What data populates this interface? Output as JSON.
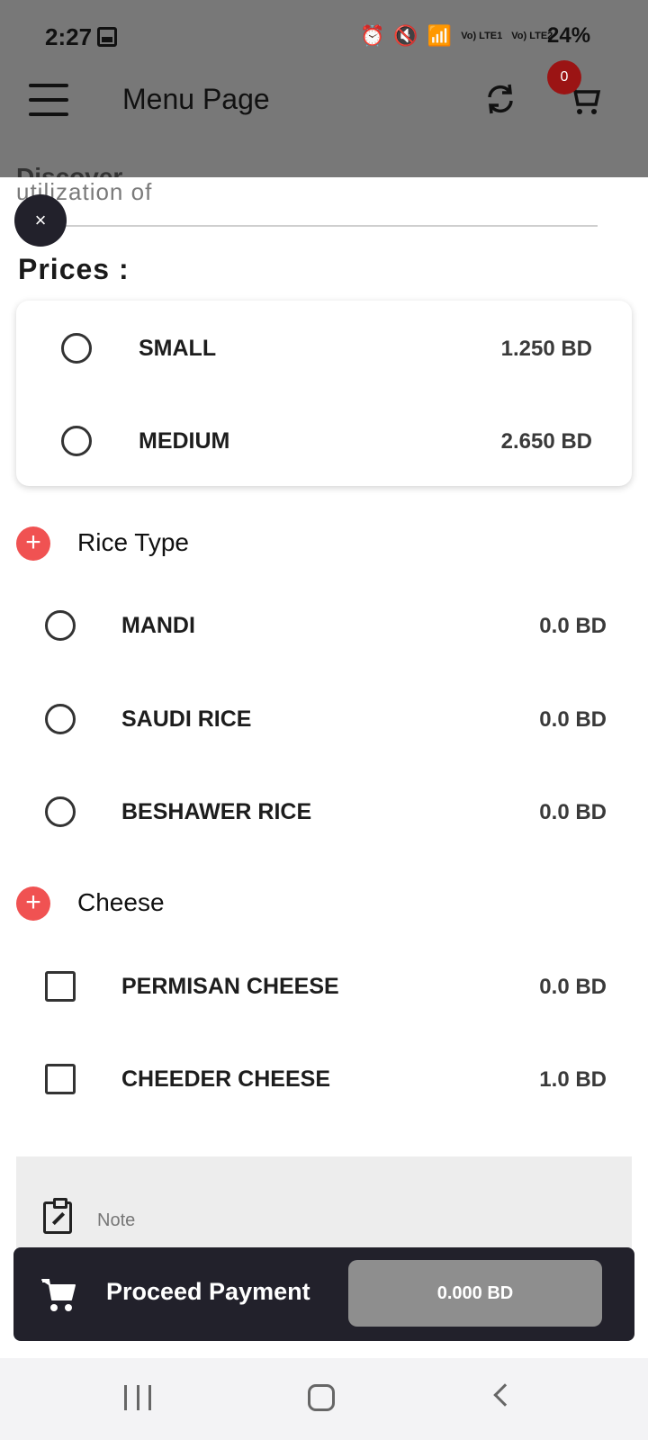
{
  "status_bar": {
    "time": "2:27",
    "signal_text": "Vo) LTE1",
    "signal_text_2": "Vo) LTE2",
    "battery": "24%"
  },
  "app_bar": {
    "title": "Menu Page",
    "cart_count": "0"
  },
  "sheet": {
    "behind_text": "Discover",
    "description_fragment": "utilization of",
    "close_label": "×",
    "prices_title": "Prices :",
    "prices": [
      {
        "label": "SMALL",
        "price": "1.250 BD",
        "selected": false
      },
      {
        "label": "MEDIUM",
        "price": "2.650 BD",
        "selected": false
      }
    ],
    "groups": [
      {
        "title": "Rice Type",
        "control": "radio",
        "options": [
          {
            "label": "MANDI",
            "price": "0.0 BD",
            "selected": false
          },
          {
            "label": "SAUDI RICE",
            "price": "0.0 BD",
            "selected": false
          },
          {
            "label": "BESHAWER RICE",
            "price": "0.0 BD",
            "selected": false
          }
        ]
      },
      {
        "title": "Cheese",
        "control": "checkbox",
        "options": [
          {
            "label": "PERMISAN CHEESE",
            "price": "0.0 BD",
            "selected": false
          },
          {
            "label": "CHEEDER CHEESE",
            "price": "1.0 BD",
            "selected": false
          }
        ]
      }
    ],
    "note_placeholder": "Note"
  },
  "payment": {
    "label": "Proceed Payment",
    "total": "0.000 BD"
  },
  "colors": {
    "accent_red": "#f05252",
    "dark": "#22212b",
    "badge": "#9b1414"
  }
}
